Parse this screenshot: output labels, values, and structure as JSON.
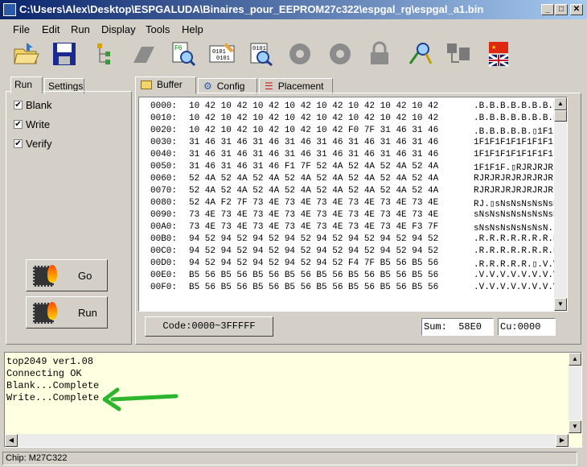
{
  "window": {
    "title": "C:\\Users\\Alex\\Desktop\\ESPGALUDA\\Binaires_pour_EEPROM27c322\\espgal_rg\\espgal_a1.bin",
    "minimize": "_",
    "maximize": "□",
    "close": "✕"
  },
  "menu": [
    "File",
    "Edit",
    "Run",
    "Display",
    "Tools",
    "Help"
  ],
  "toolbar": [
    "open-icon",
    "save-icon",
    "tree-icon",
    "eraser-icon",
    "find-icon",
    "binary-icon",
    "chip-search-icon",
    "disc-icon",
    "disc2-icon",
    "lock-icon",
    "probe-icon",
    "device-icon",
    "flags-icon"
  ],
  "left_tabs": {
    "run": "Run",
    "settings": "Settings"
  },
  "options": {
    "blank": {
      "label": "Blank",
      "checked": true
    },
    "write": {
      "label": "Write",
      "checked": true
    },
    "verify": {
      "label": "Verify",
      "checked": true
    }
  },
  "buttons": {
    "go": "Go",
    "run": "Run"
  },
  "right_tabs": {
    "buffer": "Buffer",
    "config": "Config",
    "placement": "Placement"
  },
  "hex_rows": [
    {
      "addr": "0000:",
      "bytes": "10 42 10 42 10 42 10 42 10 42 10 42 10 42 10 42",
      "ascii": ".B.B.B.B.B.B.B.B"
    },
    {
      "addr": "0010:",
      "bytes": "10 42 10 42 10 42 10 42 10 42 10 42 10 42 10 42",
      "ascii": ".B.B.B.B.B.B.B.B"
    },
    {
      "addr": "0020:",
      "bytes": "10 42 10 42 10 42 10 42 10 42 F0 7F 31 46 31 46",
      "ascii": ".B.B.B.B.B.▯1F1F"
    },
    {
      "addr": "0030:",
      "bytes": "31 46 31 46 31 46 31 46 31 46 31 46 31 46 31 46",
      "ascii": "1F1F1F1F1F1F1F1F"
    },
    {
      "addr": "0040:",
      "bytes": "31 46 31 46 31 46 31 46 31 46 31 46 31 46 31 46",
      "ascii": "1F1F1F1F1F1F1F1F"
    },
    {
      "addr": "0050:",
      "bytes": "31 46 31 46 31 46 F1 7F 52 4A 52 4A 52 4A 52 4A",
      "ascii": "1F1F1F.▯RJRJRJRJ"
    },
    {
      "addr": "0060:",
      "bytes": "52 4A 52 4A 52 4A 52 4A 52 4A 52 4A 52 4A 52 4A",
      "ascii": "RJRJRJRJRJRJRJRJ"
    },
    {
      "addr": "0070:",
      "bytes": "52 4A 52 4A 52 4A 52 4A 52 4A 52 4A 52 4A 52 4A",
      "ascii": "RJRJRJRJRJRJRJRJ"
    },
    {
      "addr": "0080:",
      "bytes": "52 4A F2 7F 73 4E 73 4E 73 4E 73 4E 73 4E 73 4E",
      "ascii": "RJ.▯sNsNsNsNsNsN"
    },
    {
      "addr": "0090:",
      "bytes": "73 4E 73 4E 73 4E 73 4E 73 4E 73 4E 73 4E 73 4E",
      "ascii": "sNsNsNsNsNsNsNsN"
    },
    {
      "addr": "00A0:",
      "bytes": "73 4E 73 4E 73 4E 73 4E 73 4E 73 4E 73 4E F3 7F",
      "ascii": "sNsNsNsNsNsNsN.▯"
    },
    {
      "addr": "00B0:",
      "bytes": "94 52 94 52 94 52 94 52 94 52 94 52 94 52 94 52",
      "ascii": ".R.R.R.R.R.R.R.R"
    },
    {
      "addr": "00C0:",
      "bytes": "94 52 94 52 94 52 94 52 94 52 94 52 94 52 94 52",
      "ascii": ".R.R.R.R.R.R.R.R"
    },
    {
      "addr": "00D0:",
      "bytes": "94 52 94 52 94 52 94 52 94 52 F4 7F B5 56 B5 56",
      "ascii": ".R.R.R.R.R.▯.V.V"
    },
    {
      "addr": "00E0:",
      "bytes": "B5 56 B5 56 B5 56 B5 56 B5 56 B5 56 B5 56 B5 56",
      "ascii": ".V.V.V.V.V.V.V.V"
    },
    {
      "addr": "00F0:",
      "bytes": "B5 56 B5 56 B5 56 B5 56 B5 56 B5 56 B5 56 B5 56",
      "ascii": ".V.V.V.V.V.V.V.V"
    }
  ],
  "code_range": "Code:0000~3FFFFF",
  "sum": "Sum:  58E0",
  "cursor": "Cu:0000",
  "log_lines": [
    "top2049 ver1.08",
    "Connecting OK",
    "Blank...Complete",
    "Write...Complete"
  ],
  "arrow_color": "#2db52d",
  "status": "Chip:  M27C322"
}
